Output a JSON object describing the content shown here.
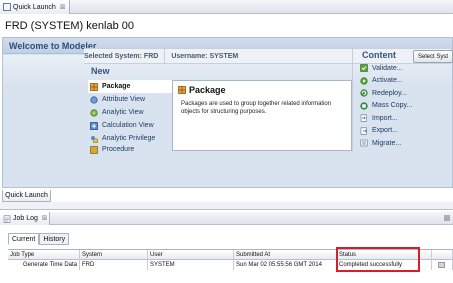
{
  "top_tab": {
    "label": "Quick Launch",
    "close": "☒"
  },
  "title": "FRD (SYSTEM)  kenlab 00",
  "welcome": "Welcome to Modeler",
  "system": {
    "selected_label": "Selected System: FRD",
    "username_label": "Username: SYSTEM",
    "select_button": "Select Syst"
  },
  "new_section": {
    "heading": "New",
    "items": [
      {
        "label": "Package",
        "icon": "package-icon"
      },
      {
        "label": "Attribute View",
        "icon": "attribute-view-icon"
      },
      {
        "label": "Analytic View",
        "icon": "analytic-view-icon"
      },
      {
        "label": "Calculation View",
        "icon": "calculation-view-icon"
      },
      {
        "label": "Analytic Privilege",
        "icon": "analytic-privilege-icon"
      },
      {
        "label": "Procedure",
        "icon": "procedure-icon"
      }
    ]
  },
  "package_panel": {
    "title": "Package",
    "description": "Packages are used to group together related information objects for structuring purposes."
  },
  "content_section": {
    "heading": "Content",
    "items": [
      {
        "label": "Validate...",
        "icon": "validate-icon"
      },
      {
        "label": "Activate...",
        "icon": "activate-icon"
      },
      {
        "label": "Redeploy...",
        "icon": "redeploy-icon"
      },
      {
        "label": "Mass Copy...",
        "icon": "mass-copy-icon"
      },
      {
        "label": "Import...",
        "icon": "import-icon"
      },
      {
        "label": "Export...",
        "icon": "export-icon"
      },
      {
        "label": "Migrate...",
        "icon": "migrate-icon"
      }
    ]
  },
  "bottom_tab": {
    "label": "Quick Launch"
  },
  "job_log": {
    "tab_label": "Job Log",
    "close": "☒",
    "subtabs": [
      "Current",
      "History"
    ],
    "columns": [
      "Job Type",
      "System",
      "User",
      "Submitted At",
      "Status"
    ],
    "rows": [
      {
        "job_type": "Generate Time Data",
        "system": "FRD",
        "user": "SYSTEM",
        "submitted_at": "Sun Mar 02 05:55:56 GMT 2014",
        "status": "Completed successfully"
      }
    ]
  },
  "colors": {
    "highlight": "#d81d2a",
    "panel": "#d9e3ef",
    "heading": "#33577f"
  }
}
